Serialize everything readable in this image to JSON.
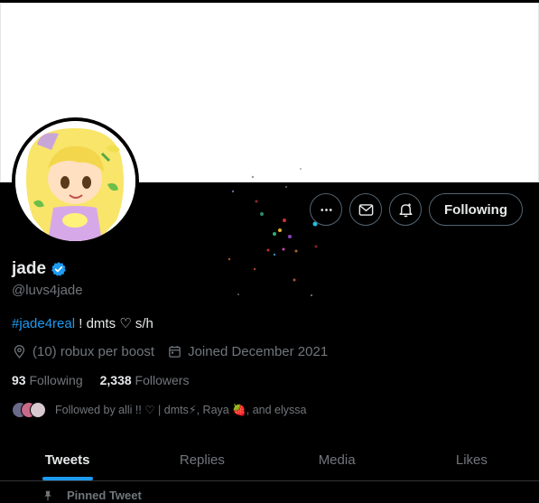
{
  "profile": {
    "name": "jade",
    "handle": "@luvs4jade",
    "bio_hashtag": "#jade4real",
    "bio_rest": " ! dmts ♡ s/h",
    "location": "(10) robux per boost",
    "joined": "Joined December 2021",
    "following_count": "93",
    "following_label": "Following",
    "followers_count": "2,338",
    "followers_label": "Followers",
    "followed_by": "Followed by alli !! ♡ | dmts⚡, Raya 🍓, and elyssa"
  },
  "actions": {
    "follow_label": "Following"
  },
  "tabs": [
    "Tweets",
    "Replies",
    "Media",
    "Likes"
  ],
  "pinned_label": "Pinned Tweet",
  "colors": {
    "accent": "#1d9bf0",
    "background": "#000000",
    "muted": "#71767b"
  },
  "icons": [
    "more-icon",
    "message-icon",
    "notification-icon",
    "verified-badge-icon",
    "location-icon",
    "calendar-icon",
    "pin-icon"
  ]
}
